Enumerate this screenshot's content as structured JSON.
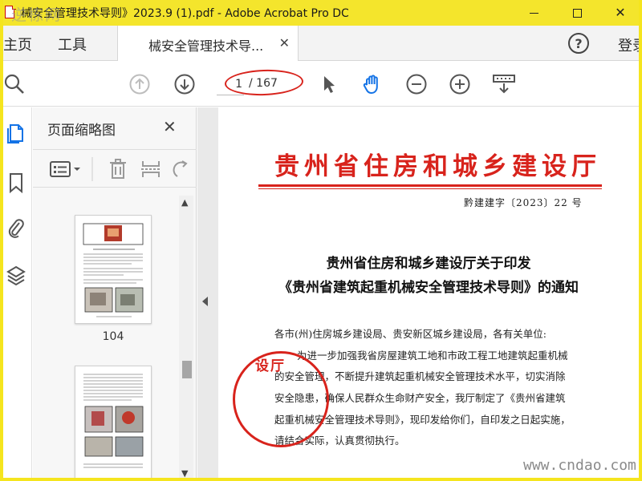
{
  "window": {
    "title": "械安全管理技术导则》2023.9 (1).pdf - Adobe Acrobat Pro DC",
    "close_glyph": "✕"
  },
  "watermarks": {
    "top": "逆栋网",
    "bottom": "www.cndao.com"
  },
  "menu": {
    "home": "主页",
    "tools": "工具",
    "doc_tab": "械安全管理技术导...",
    "doc_tab_close": "✕",
    "help_glyph": "?",
    "login": "登录"
  },
  "toolbar": {
    "current_page": "1",
    "total_pages": "/ 167"
  },
  "panel": {
    "title": "页面缩略图",
    "close_glyph": "✕",
    "thumb_label": "104",
    "scroll_up": "▲",
    "scroll_down": "▼"
  },
  "document": {
    "header": "贵州省住房和城乡建设厅",
    "number": "黔建建字〔2023〕22 号",
    "title_line1": "贵州省住房和城乡建设厅关于印发",
    "title_line2": "《贵州省建筑起重机械安全管理技术导则》的通知",
    "addressee": "各市(州)住房城乡建设局、贵安新区城乡建设局，各有关单位:",
    "body": [
      "为进一步加强我省房屋建筑工地和市政工程工地建筑起重机械",
      "的安全管理，不断提升建筑起重机械安全管理技术水平，切实消除",
      "安全隐患，确保人民群众生命财产安全，我厅制定了《贵州省建筑",
      "起重机械安全管理技术导则》，现印发给你们，自印发之日起实施，",
      "请结合实际，认真贯彻执行。"
    ],
    "stamp_text": "设厅"
  },
  "colors": {
    "titlebar": "#f4e52c",
    "accent_red": "#d8231c",
    "icon_blue": "#1473e6",
    "icon_gray": "#555555"
  }
}
